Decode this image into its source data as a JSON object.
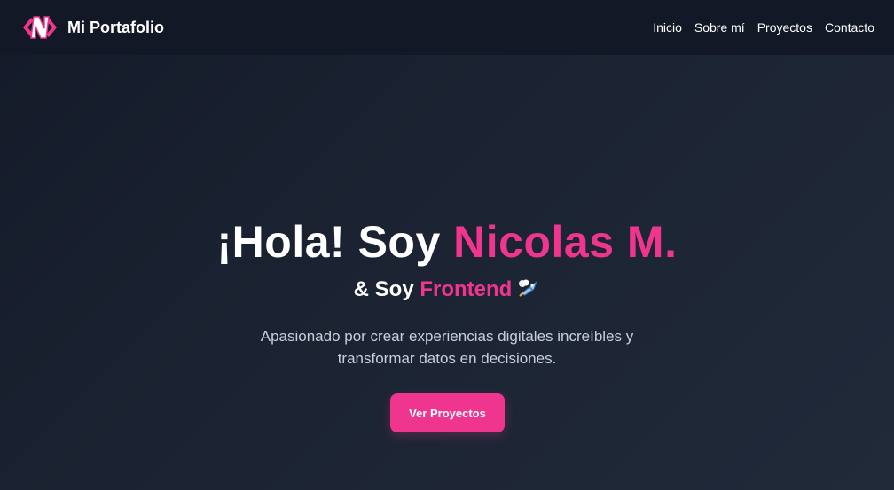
{
  "header": {
    "brand_name": "Mi Portafolio",
    "logo_icon": "code-bracket-n-logo",
    "nav": [
      {
        "label": "Inicio"
      },
      {
        "label": "Sobre mí"
      },
      {
        "label": "Proyectos"
      },
      {
        "label": "Contacto"
      }
    ]
  },
  "hero": {
    "greeting": "¡Hola! Soy ",
    "name": "Nicolas M.",
    "sub_prefix": "& Soy ",
    "role": "Frontend",
    "role_icon": "rocket-icon",
    "description": "Apasionado por crear experiencias digitales increíbles y transformar datos en decisiones.",
    "cta_label": "Ver Proyectos"
  },
  "colors": {
    "accent": "#f0358f",
    "background": "#1c2433",
    "navbar": "#121826",
    "text": "#ffffff",
    "muted_text": "#c9ced8"
  }
}
